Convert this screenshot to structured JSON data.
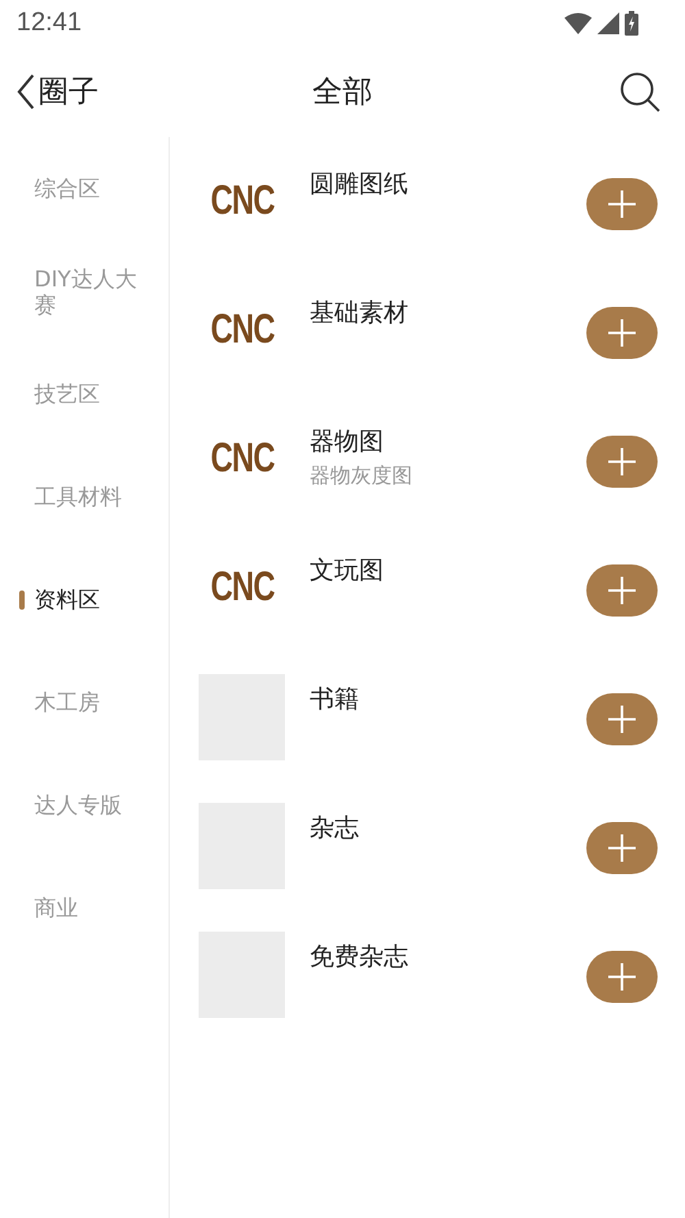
{
  "status_bar": {
    "time": "12:41"
  },
  "header": {
    "back_label": "圈子",
    "title": "全部"
  },
  "sidebar": {
    "items": [
      {
        "label": "综合区",
        "selected": false
      },
      {
        "label": "DIY达人大赛",
        "selected": false
      },
      {
        "label": "技艺区",
        "selected": false
      },
      {
        "label": "工具材料",
        "selected": false
      },
      {
        "label": "资料区",
        "selected": true
      },
      {
        "label": "木工房",
        "selected": false
      },
      {
        "label": "达人专版",
        "selected": false
      },
      {
        "label": "商业",
        "selected": false
      }
    ]
  },
  "groups": [
    {
      "title": "圆雕图纸",
      "thumb": {
        "kind": "logo",
        "text": "CNC"
      }
    },
    {
      "title": "基础素材",
      "thumb": {
        "kind": "logo",
        "text": "CNC"
      }
    },
    {
      "title": "器物图",
      "subtitle": "器物灰度图",
      "thumb": {
        "kind": "logo",
        "text": "CNC"
      }
    },
    {
      "title": "文玩图",
      "thumb": {
        "kind": "logo",
        "text": "CNC"
      }
    },
    {
      "title": "书籍",
      "thumb": {
        "kind": "blank"
      }
    },
    {
      "title": "杂志",
      "thumb": {
        "kind": "blank"
      }
    },
    {
      "title": "免费杂志",
      "thumb": {
        "kind": "blank"
      }
    }
  ]
}
